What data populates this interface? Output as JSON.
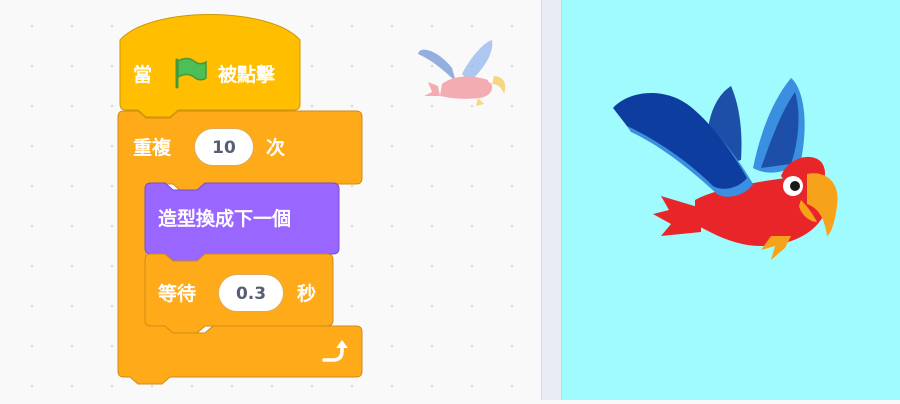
{
  "code_area": {
    "hat_block": {
      "prefix": "當",
      "flag_icon": "green-flag-icon",
      "suffix": "被點擊"
    },
    "repeat_block": {
      "prefix": "重複",
      "count": "10",
      "suffix": "次",
      "loop_icon": "loop-arrow-icon"
    },
    "costume_block": {
      "label": "造型換成下一個"
    },
    "wait_block": {
      "prefix": "等待",
      "seconds": "0.3",
      "suffix": "秒"
    },
    "sprite_thumbnail": "parrot"
  },
  "stage": {
    "sprite": "parrot"
  },
  "colors": {
    "events": "#ffbf00",
    "control": "#ffab19",
    "looks": "#9966ff",
    "stage_bg": "#9ffbfd"
  }
}
